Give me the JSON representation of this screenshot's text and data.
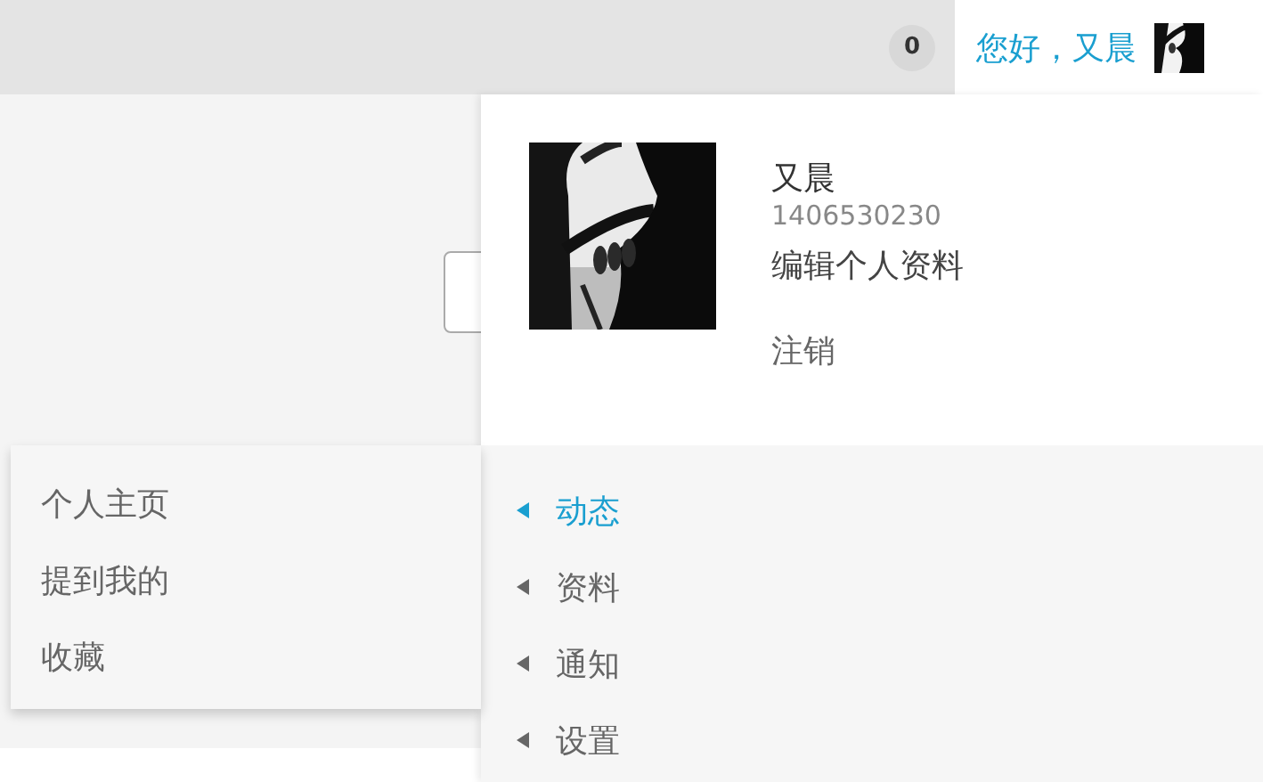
{
  "top_bar": {
    "notification_count": "0",
    "greeting": "您好，又晨"
  },
  "user_menu": {
    "name": "又晨",
    "user_id": "1406530230",
    "edit_profile": "编辑个人资料",
    "logout": "注销",
    "items": [
      {
        "label": "动态",
        "selected": true
      },
      {
        "label": "资料",
        "selected": false
      },
      {
        "label": "通知",
        "selected": false
      },
      {
        "label": "设置",
        "selected": false
      }
    ]
  },
  "submenu": {
    "items": [
      "个人主页",
      "提到我的",
      "收藏"
    ]
  }
}
